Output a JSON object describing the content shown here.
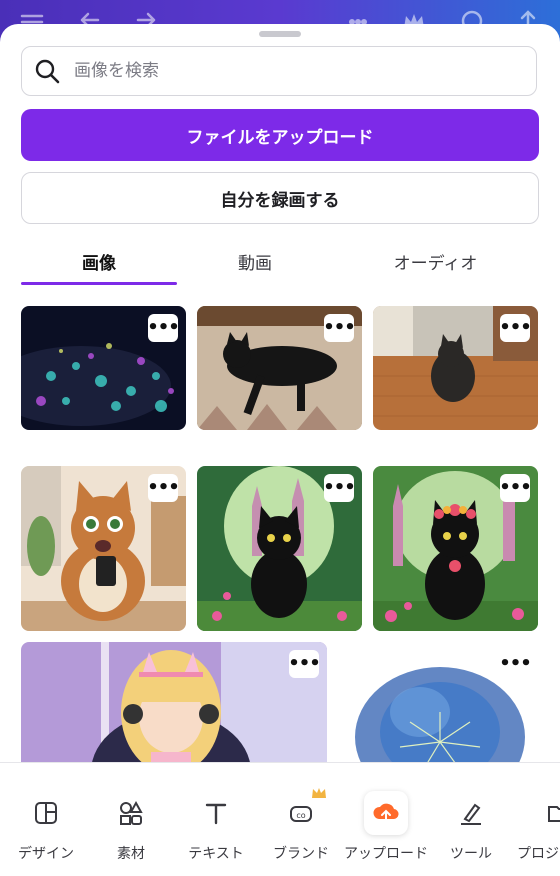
{
  "search": {
    "placeholder": "画像を検索"
  },
  "buttons": {
    "upload": "ファイルをアップロード",
    "record": "自分を録画する"
  },
  "tabs": [
    {
      "label": "画像",
      "active": true
    },
    {
      "label": "動画",
      "active": false
    },
    {
      "label": "オーディオ",
      "active": false
    }
  ],
  "media": {
    "more_label": "•••",
    "items": [
      {
        "subject": "glowing jellyfish"
      },
      {
        "subject": "black cat lying on blanket"
      },
      {
        "subject": "black cat on wooden floor"
      },
      {
        "subject": "cartoon tabby cat with smartphone"
      },
      {
        "subject": "black cat fantasy castle"
      },
      {
        "subject": "black cat with flower crown"
      },
      {
        "subject": "anime girl with headphones"
      },
      {
        "subject": "blue watercolor dandelion"
      }
    ]
  },
  "bottom_nav": [
    {
      "label": "デザイン",
      "icon": "design-icon"
    },
    {
      "label": "素材",
      "icon": "elements-icon"
    },
    {
      "label": "テキスト",
      "icon": "text-icon"
    },
    {
      "label": "ブランド",
      "icon": "brand-icon"
    },
    {
      "label": "アップロード",
      "icon": "upload-icon",
      "active": true
    },
    {
      "label": "ツール",
      "icon": "tools-icon"
    },
    {
      "label": "プロジェ",
      "icon": "projects-icon"
    }
  ],
  "colors": {
    "accent": "#7d2ae8",
    "upload_icon": "#ff6a2b",
    "crown": "#f2b441"
  }
}
